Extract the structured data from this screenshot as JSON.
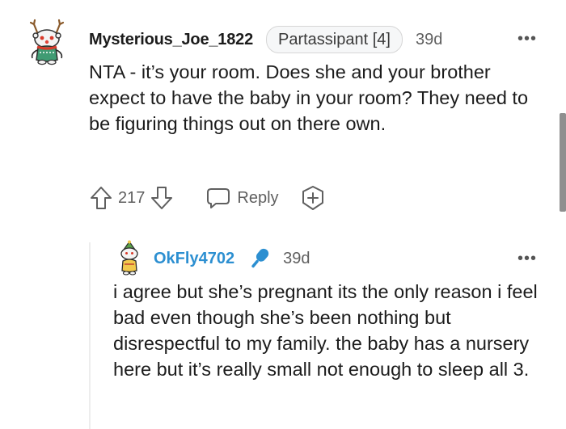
{
  "comment": {
    "author": "Mysterious_Joe_1822",
    "flair": "Partassipant [4]",
    "age": "39d",
    "more": "•••",
    "body": "NTA - it’s your room. Does she and your brother expect to have the baby in your room? They need to be figuring things out on there own.",
    "score": "217",
    "reply_label": "Reply",
    "icons": {
      "avatar": "snoo-avatar-icon",
      "upvote": "upvote-arrow-icon",
      "downvote": "downvote-arrow-icon",
      "reply": "speech-bubble-icon",
      "award": "award-plus-icon"
    }
  },
  "reply": {
    "author": "OkFly4702",
    "age": "39d",
    "more": "•••",
    "body": "i agree but she’s pregnant its the only reason i feel bad even though she’s been nothing but disrespectful to my family. the baby has a nursery here but it’s really small not enough to sleep all 3.",
    "icons": {
      "avatar": "snoo-avatar-icon",
      "badge": "microphone-icon"
    }
  },
  "colors": {
    "text": "#1c1c1c",
    "meta": "#5f5f5f",
    "reply_author": "#2c8fd1",
    "mic_badge": "#2c8fd1",
    "flair_border": "#d6d6d6"
  }
}
